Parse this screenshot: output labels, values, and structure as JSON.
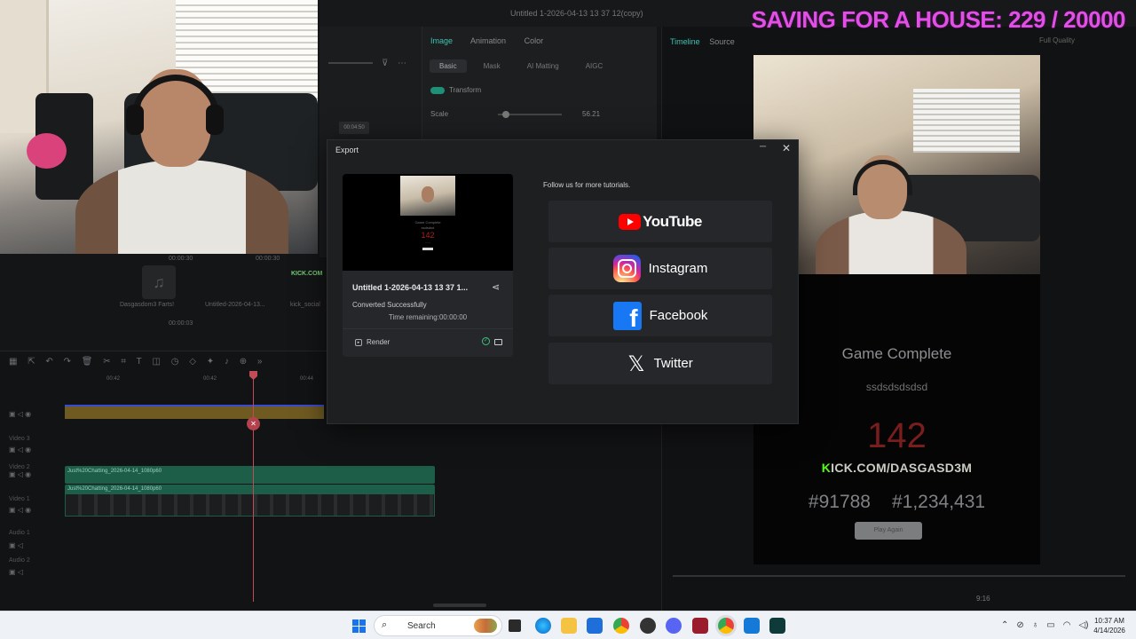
{
  "editor": {
    "window_title": "Untitled 1-2026-04-13 13 37 12(copy)",
    "property_tabs": [
      "Image",
      "Animation",
      "Color"
    ],
    "sub_tabs": [
      "Basic",
      "Mask",
      "AI Matting",
      "AIGC"
    ],
    "transform_label": "Transform",
    "scale_label": "Scale",
    "scale_value": "56.21",
    "preview_tabs": [
      "Timeline",
      "Source"
    ],
    "fullscreen_label": "Full Quality",
    "media_clips": [
      "Dasgasdom3 Farts!",
      "Untitled-2026-04-13...",
      "kick_social"
    ],
    "media_times": [
      "00:00:30",
      "00:00:30",
      "00:00:03"
    ],
    "small_timecode": "00:04:50",
    "ruler_ticks": [
      "00:42",
      "00:42",
      "00:44"
    ],
    "track_labels": [
      "Video 3",
      "Video 2",
      "Video 1",
      "Audio 1",
      "Audio 2"
    ],
    "clip_names": [
      "Just%20Chatting_2026-04-14_1080p60",
      "Just%20Chatting_2026-04-14_1080p60"
    ],
    "zoom_label": "9:16"
  },
  "overlay": {
    "goal_text": "SAVING FOR A HOUSE: 229 / 20000"
  },
  "game_preview": {
    "title": "Game Complete",
    "username": "ssdsdsdsdsd",
    "score": "142",
    "kick_prefix": "K",
    "kick_url": "ICK.COM/DASGASD3M",
    "rank_left": "#91788",
    "rank_right": "#1,234,431",
    "button": "Play Again"
  },
  "export_dialog": {
    "title": "Export",
    "file_name": "Untitled 1-2026-04-13 13 37 1...",
    "status": "Converted Successfully",
    "time_remaining": "Time remaining:00:00:00",
    "render_label": "Render",
    "follow_text": "Follow us for more tutorials.",
    "social": [
      {
        "name": "YouTube"
      },
      {
        "name": "Instagram"
      },
      {
        "name": "Facebook"
      },
      {
        "name": "Twitter"
      }
    ],
    "thumb_score": "142"
  },
  "taskbar": {
    "search_placeholder": "Search",
    "time": "10:37 AM",
    "date": "4/14/2026"
  },
  "colors": {
    "accent": "#3ec2b0",
    "goal_text": "#e24fe6",
    "youtube": "#ff0000",
    "facebook": "#1877f2"
  }
}
